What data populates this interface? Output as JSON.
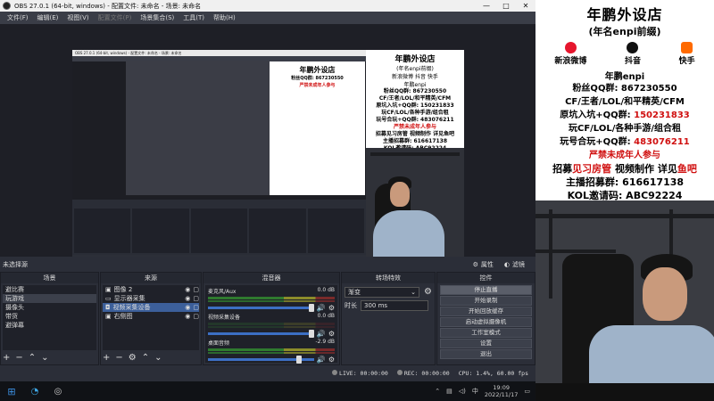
{
  "window": {
    "title": "OBS 27.0.1 (64-bit, windows) - 配置文件: 未命名 - 场景: 未命名",
    "controls": [
      "—",
      "□",
      "✕"
    ]
  },
  "menu": [
    "文件(F)",
    "编辑(E)",
    "视图(V)",
    "配置文件(P)",
    "场景集合(S)",
    "工具(T)",
    "帮助(H)"
  ],
  "nested_preview": {
    "title": "OBS 27.0.1 (64-bit, windows) - 配置文件: 未命名 - 场景: 未命名"
  },
  "inner_banner": {
    "title": "年鹏外设店",
    "subtitle": "(年名enpi前缀)",
    "socials": [
      "新浪微博",
      "抖音",
      "快手"
    ],
    "handle": "年鹏enpi",
    "lines": [
      "粉丝QQ群: 867230550",
      "CF/王者/LOL/和平精英/CFM",
      "原坑入坑+QQ群: 150231833",
      "玩CF/LOL/各种手游/组合租",
      "玩号合玩+QQ群: 483076211",
      "严禁未成年人参与",
      "招募见习房管 视频制作 详见鱼吧",
      "主播招募群: 616617138",
      "KOL邀请码: ABC92224"
    ]
  },
  "source_bar": {
    "no_source": "未选择源",
    "properties": "属性",
    "filters": "滤镜"
  },
  "docks": {
    "scenes": {
      "title": "场景",
      "items": [
        "避比赛",
        "玩游戏",
        "摄像头",
        "带货",
        "避弹幕"
      ],
      "selected": 1
    },
    "sources": {
      "title": "来源",
      "items": [
        {
          "name": "图像 2",
          "type_icon": "image-icon"
        },
        {
          "name": "显示器采集",
          "type_icon": "monitor-icon"
        },
        {
          "name": "视频采集设备",
          "type_icon": "camera-icon"
        },
        {
          "name": "右侧图",
          "type_icon": "image-icon"
        }
      ],
      "selected": 2
    },
    "mixer": {
      "title": "混音器",
      "channels": [
        {
          "name": "麦克风/Aux",
          "db": "0.0 dB",
          "level": 0.6
        },
        {
          "name": "视频采集设备",
          "db": "0.0 dB",
          "level": 0.0
        },
        {
          "name": "桌面音频",
          "db": "-2.9 dB",
          "level": 0.55
        }
      ]
    },
    "transitions": {
      "title": "转场特效",
      "selected": "渐变",
      "duration_label": "时长",
      "duration": "300 ms"
    },
    "controls": {
      "title": "控件",
      "buttons": [
        "停止直播",
        "开始录制",
        "开始回放缓存",
        "启动虚拟摄像机",
        "工作室模式",
        "设置",
        "退出"
      ]
    }
  },
  "status": {
    "live": "LIVE: 00:00:00",
    "rec": "REC: 00:00:00",
    "cpu": "CPU: 1.4%, 60.00 fps"
  },
  "taskbar": {
    "ime": "中",
    "time": "19:09",
    "date": "2022/11/17"
  },
  "stream_banner": {
    "title": "年鹏外设店",
    "subtitle": "(年名enpi前缀)",
    "socials": [
      {
        "name": "新浪微博",
        "color": "#e6162d"
      },
      {
        "name": "抖音",
        "color": "#111111"
      },
      {
        "name": "快手",
        "color": "#ff6a00"
      }
    ],
    "handle": "年鹏enpi",
    "fans_qq": "粉丝QQ群: 867230550",
    "games": "CF/王者/LOL/和平精英/CFM",
    "group1_label": "原坑入坑+QQ群: ",
    "group1_num": "150231833",
    "games2": "玩CF/LOL/各种手游/组合租",
    "group2_label": "玩号合玩+QQ群: ",
    "group2_num": "483076211",
    "warning": "严禁未成年人参与",
    "recruit": [
      {
        "t": "招募",
        "red": false
      },
      {
        "t": "见习房管",
        "red": true
      },
      {
        "t": " 视频制作 ",
        "red": false
      },
      {
        "t": "详见",
        "red": false
      },
      {
        "t": "鱼吧",
        "red": true
      }
    ],
    "streamer_group": "主播招募群: 616617138",
    "kol": "KOL邀请码: ABC92224"
  }
}
